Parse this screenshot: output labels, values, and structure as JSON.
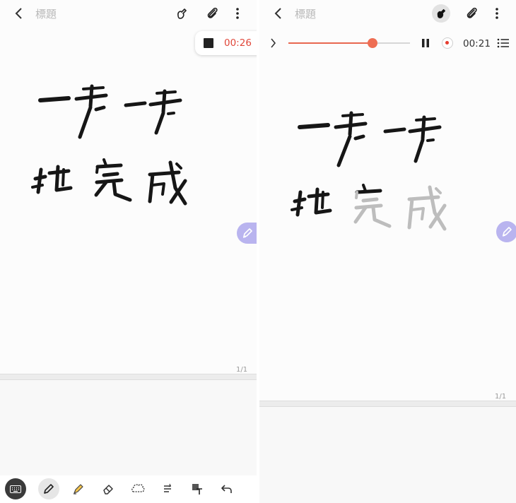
{
  "left": {
    "title": "標題",
    "recording": {
      "time": "00:26"
    },
    "page_indicator": "1/1"
  },
  "right": {
    "title": "標題",
    "playback": {
      "progress": 0.69,
      "time": "00:21"
    },
    "page_indicator": "1/1"
  },
  "handwriting_alt": "handwritten strokes (hand-drawn ink, no typed text)",
  "icons": {
    "back": "chevron-left-icon",
    "pen_mode": "pen-hand-icon",
    "attach": "paperclip-icon",
    "more": "more-vertical-icon",
    "stop": "stop-icon",
    "play": "chevron-right-icon",
    "pause": "pause-icon",
    "record": "record-icon",
    "list": "list-icon",
    "floating_pen": "pen-icon",
    "keyboard": "keyboard-icon",
    "pen_tool": "pen-icon",
    "highlighter": "highlighter-icon",
    "eraser": "eraser-icon",
    "lasso": "lasso-icon",
    "text_convert": "text-convert-icon",
    "shape_text": "text-style-icon",
    "undo": "undo-icon"
  },
  "colors": {
    "accent": "#ee6e53",
    "record_red": "#e0473a",
    "floating_button": "#b9b4ef",
    "ink": "#161616",
    "ink_faded": "#bdbdbd",
    "highlighter_yellow": "#f4c44c"
  }
}
